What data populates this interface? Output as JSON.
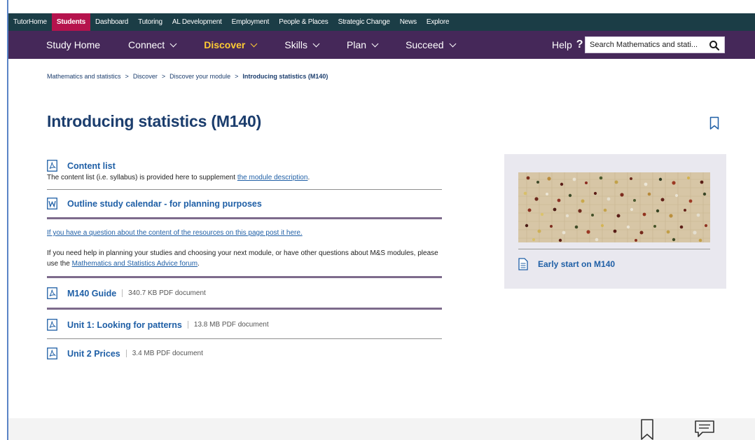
{
  "top_nav": {
    "items": [
      "TutorHome",
      "Students",
      "Dashboard",
      "Tutoring",
      "AL Development",
      "Employment",
      "People & Places",
      "Strategic Change",
      "News",
      "Explore"
    ],
    "active": "Students"
  },
  "main_nav": {
    "study_home": "Study Home",
    "connect": "Connect",
    "discover": "Discover",
    "skills": "Skills",
    "plan": "Plan",
    "succeed": "Succeed",
    "help": "Help",
    "help_mark": "?"
  },
  "search": {
    "placeholder": "Search Mathematics and stati..."
  },
  "breadcrumb": {
    "items": [
      "Mathematics and statistics",
      "Discover",
      "Discover your module"
    ],
    "current": "Introducing statistics (M140)",
    "separator": ">"
  },
  "page": {
    "title": "Introducing statistics (M140)"
  },
  "resources": {
    "content_list": {
      "label": "Content list",
      "desc_prefix": "The content list (i.e. syllabus) is provided here to supplement ",
      "desc_link": "the module description",
      "desc_suffix": "."
    },
    "calendar": {
      "label": "Outline study calendar - for planning purposes"
    },
    "question_link": "If you have a question about the content of the resources on this page post it here.",
    "advice": {
      "prefix": "If you need help in planning your studies and choosing your next module, or have other questions about M&S modules, please use the ",
      "link": "Mathematics and Statistics Advice forum",
      "suffix": "."
    },
    "files": [
      {
        "label": "M140 Guide",
        "meta": "340.7 KB PDF document"
      },
      {
        "label": "Unit 1: Looking for patterns",
        "meta": "13.8 MB PDF document"
      },
      {
        "label": "Unit 2 Prices",
        "meta": "3.4 MB PDF document"
      }
    ]
  },
  "side_card": {
    "link": "Early start on M140"
  },
  "colors": {
    "top_bar": "#1b3d46",
    "active_tab": "#b5134d",
    "main_bar": "#452859",
    "discover_accent": "#ffcc33",
    "title": "#1b3d6d",
    "link": "#1f5fa6",
    "divider_purple": "#7d6b8c",
    "card_bg": "#e9e8ef"
  }
}
